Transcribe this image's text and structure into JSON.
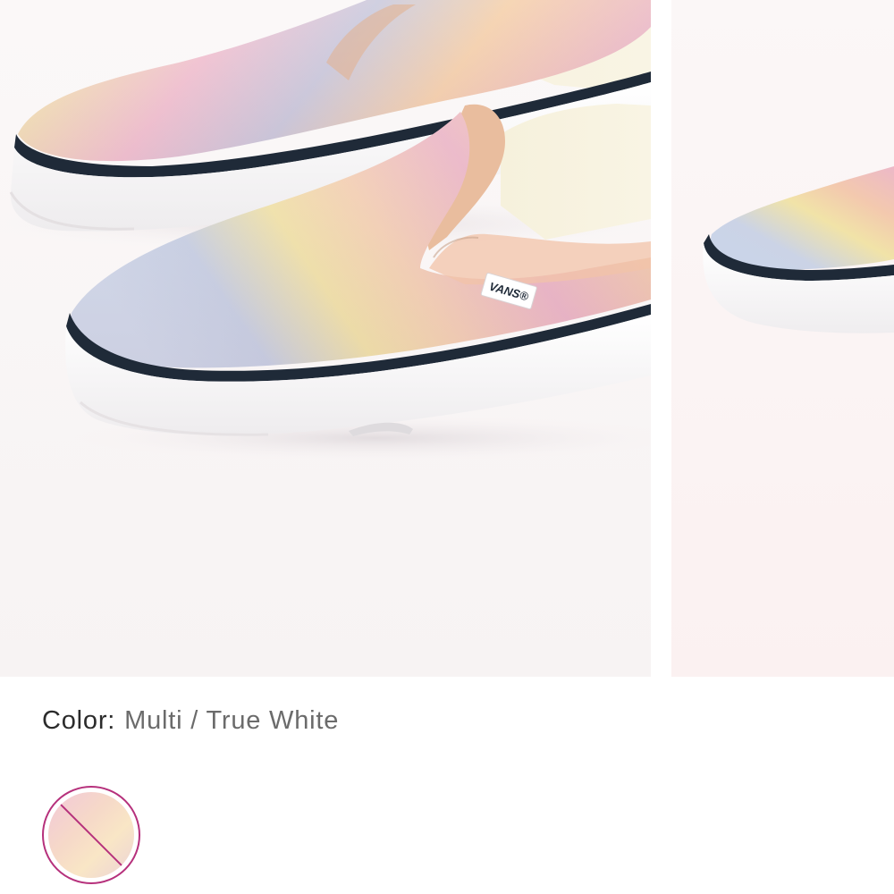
{
  "product": {
    "color_label": "Color:",
    "color_value": "Multi / True White",
    "shoe_tag_text": "VANS®"
  },
  "swatches": [
    {
      "name": "Multi / True White",
      "selected": true,
      "unavailable": true
    }
  ],
  "colors": {
    "swatch_ring": "#b6317c",
    "label_text": "#2b2b2b",
    "value_text": "#6b6b6b",
    "sole": "#ffffff",
    "foxing_stripe": "#1f2a38"
  }
}
